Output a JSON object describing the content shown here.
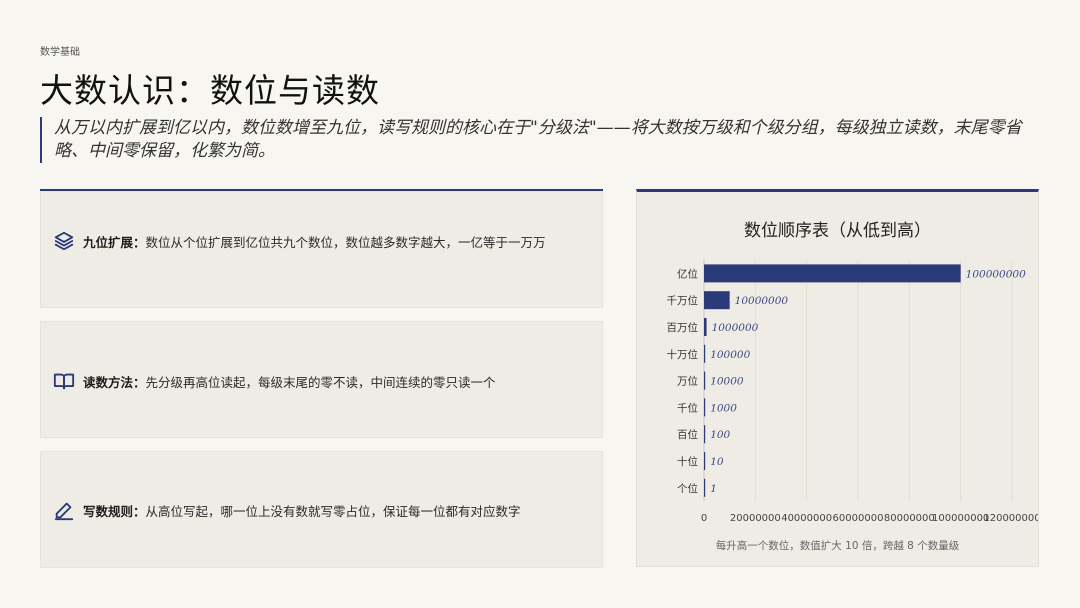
{
  "header": {
    "eyebrow": "数学基础",
    "title": "大数认识：数位与读数",
    "subtitle": "从万以内扩展到亿以内，数位数增至九位，读写规则的核心在于\"分级法\"——将大数按万级和个级分组，每级独立读数，末尾零省略、中间零保留，化繁为简。"
  },
  "cards": [
    {
      "icon": "layers-icon",
      "label": "九位扩展：",
      "text": "数位从个位扩展到亿位共九个数位，数位越多数字越大，一亿等于一万万"
    },
    {
      "icon": "open-book-icon",
      "label": "读数方法：",
      "text": "先分级再高位读起，每级末尾的零不读，中间连续的零只读一个"
    },
    {
      "icon": "pencil-icon",
      "label": "写数规则：",
      "text": "从高位写起，哪一位上没有数就写零占位，保证每一位都有对应数字"
    }
  ],
  "chart_panel": {
    "title": "数位顺序表（从低到高）",
    "note": "每升高一个数位，数值扩大 10 倍，跨越 8 个数量级"
  },
  "colors": {
    "accent": "#2b3a78",
    "background": "#f8f6f1",
    "card": "#efece6"
  },
  "chart_data": {
    "type": "bar",
    "orientation": "horizontal",
    "title": "数位顺序表（从低到高）",
    "categories": [
      "亿位",
      "千万位",
      "百万位",
      "十万位",
      "万位",
      "千位",
      "百位",
      "十位",
      "个位"
    ],
    "values": [
      100000000,
      10000000,
      1000000,
      100000,
      10000,
      1000,
      100,
      10,
      1
    ],
    "data_labels": [
      "100000000",
      "10000000",
      "1000000",
      "100000",
      "10000",
      "1000",
      "100",
      "10",
      "1"
    ],
    "x_ticks": [
      "0",
      "20000000",
      "40000000",
      "60000000",
      "80000000",
      "100000000",
      "120000000"
    ],
    "xlim": [
      0,
      120000000
    ],
    "grid": true,
    "bar_color": "#2b3a78"
  }
}
